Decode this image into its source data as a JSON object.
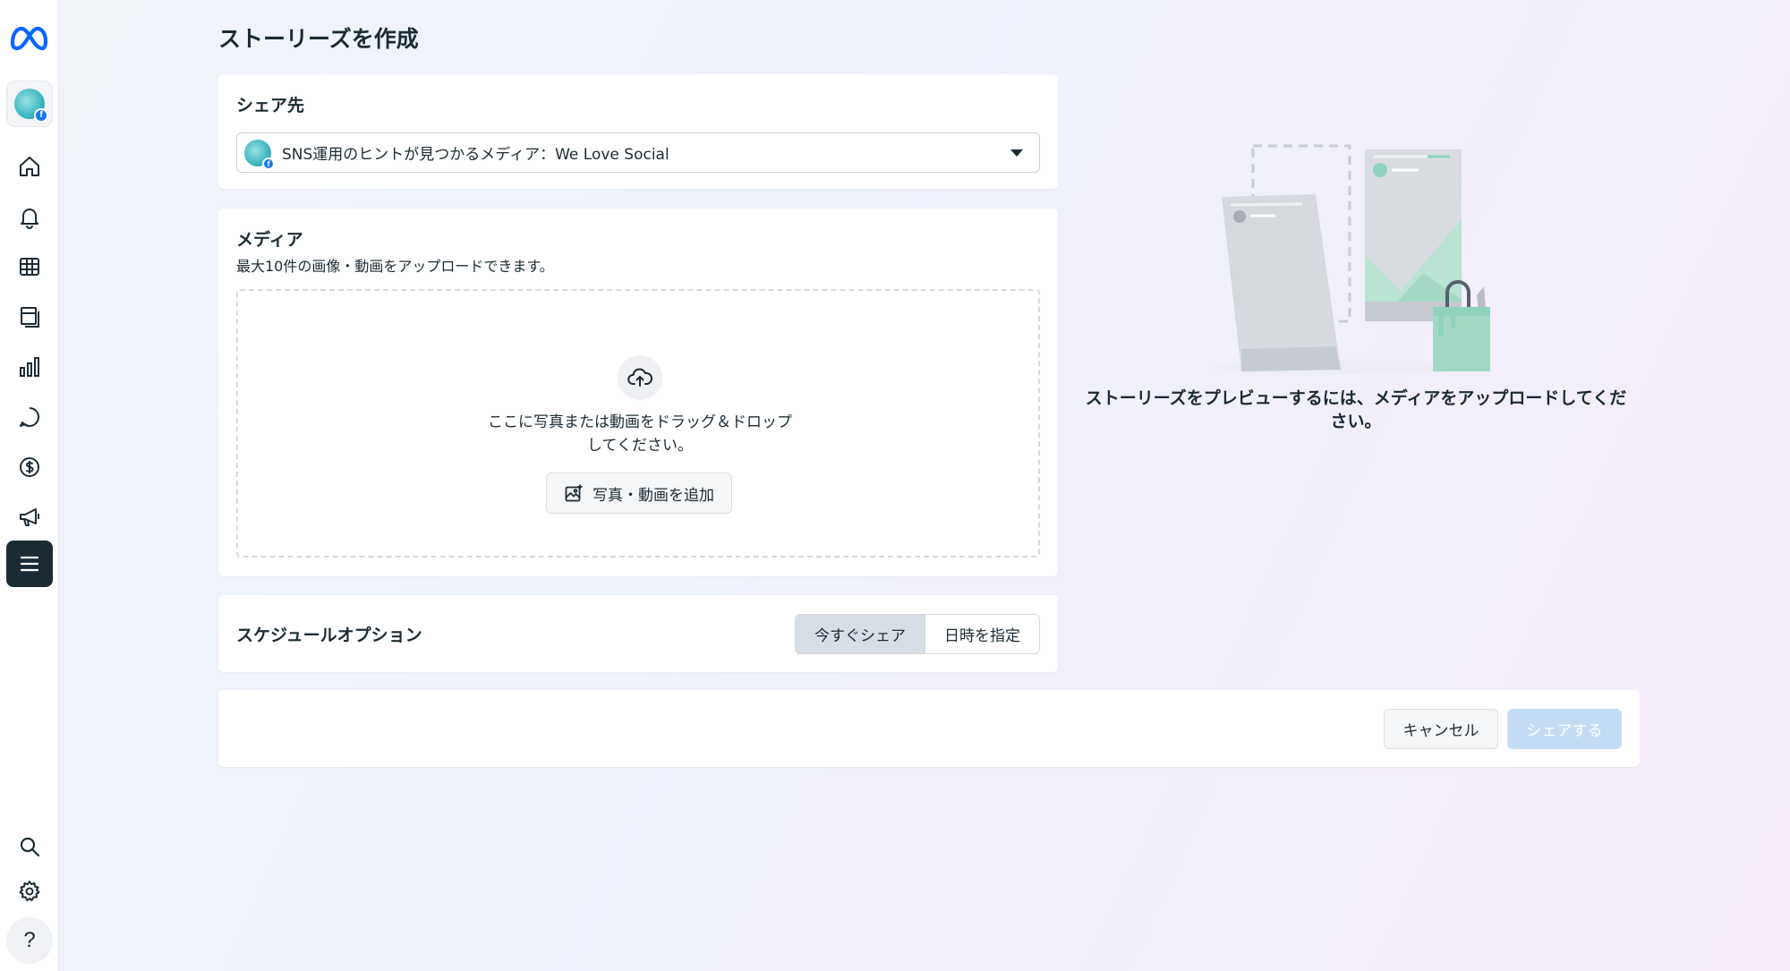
{
  "page": {
    "title": "ストーリーズを作成"
  },
  "sidebar": {
    "items": [
      {
        "name": "home-icon"
      },
      {
        "name": "bell-icon"
      },
      {
        "name": "table-icon"
      },
      {
        "name": "content-icon"
      },
      {
        "name": "insights-icon"
      },
      {
        "name": "chat-icon"
      },
      {
        "name": "dollar-icon"
      },
      {
        "name": "megaphone-icon"
      },
      {
        "name": "menu-icon"
      }
    ],
    "bottom": [
      {
        "name": "search-icon"
      },
      {
        "name": "gear-icon"
      }
    ],
    "help_label": "?",
    "accent": "#1c2b33"
  },
  "share_to": {
    "title": "シェア先",
    "selected_account": "SNS運用のヒントが見つかるメディア：We Love Social"
  },
  "media": {
    "title": "メディア",
    "subtitle": "最大10件の画像・動画をアップロードできます。",
    "drop_text_line1": "ここに写真または動画をドラッグ＆ドロップ",
    "drop_text_line2": "してください。",
    "add_button": "写真・動画を追加"
  },
  "schedule": {
    "title": "スケジュールオプション",
    "options": [
      "今すぐシェア",
      "日時を指定"
    ],
    "selected": "今すぐシェア"
  },
  "footer": {
    "cancel": "キャンセル",
    "share": "シェアする"
  },
  "preview": {
    "message": "ストーリーズをプレビューするには、メディアをアップロードしてください。"
  },
  "colors": {
    "primary_disabled": "#c5dcf5",
    "text": "#1c2b33",
    "illustration_teal": "#8fd3bf"
  }
}
